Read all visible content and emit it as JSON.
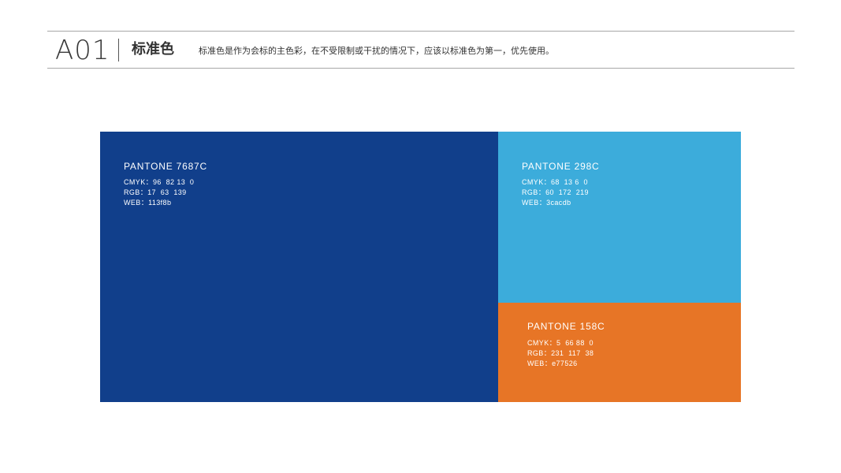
{
  "header": {
    "code": "A01",
    "title": "标准色",
    "description": "标准色是作为会标的主色彩，在不受限制或干扰的情况下，应该以标准色为第一，优先使用。"
  },
  "swatches": [
    {
      "name": "PANTONE 7687C",
      "cmyk": "CMYK：96  82 13  0",
      "rgb": "RGB：17  63  139",
      "web": "WEB：113f8b",
      "color": "#113f8b"
    },
    {
      "name": "PANTONE 298C",
      "cmyk": "CMYK：68  13 6  0",
      "rgb": "RGB：60  172  219",
      "web": "WEB：3cacdb",
      "color": "#3cacdb"
    },
    {
      "name": "PANTONE 158C",
      "cmyk": "CMYK：5  66 88  0",
      "rgb": "RGB：231  117  38",
      "web": "WEB：e77526",
      "color": "#e77526"
    }
  ]
}
